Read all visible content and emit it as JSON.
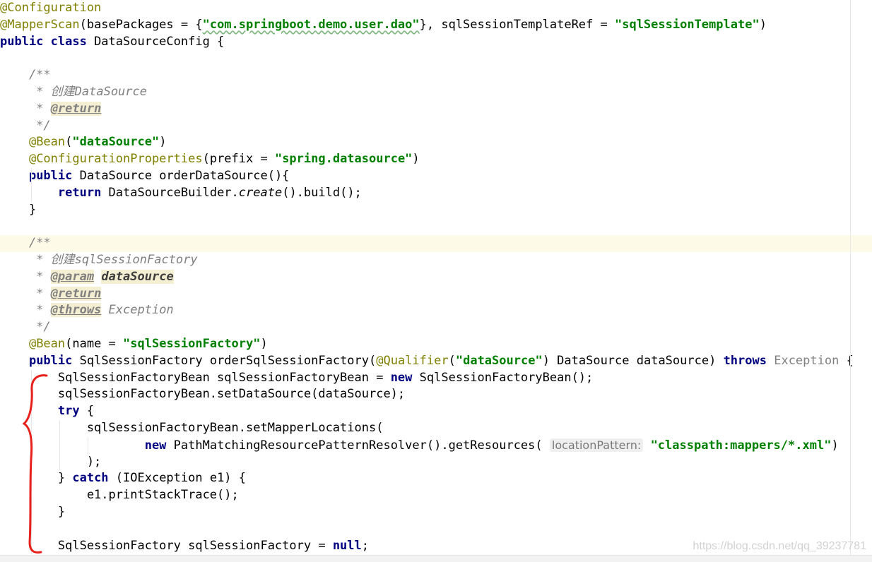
{
  "editor": {
    "lines": [
      [
        {
          "c": "annot",
          "t": "@Configuration"
        }
      ],
      [
        {
          "c": "annot",
          "t": "@MapperScan"
        },
        {
          "c": "",
          "t": "(basePackages = {"
        },
        {
          "c": "str",
          "t": "\"com.springboot.demo.user.dao\"",
          "u": true
        },
        {
          "c": "",
          "t": "}, sqlSessionTemplateRef = "
        },
        {
          "c": "str",
          "t": "\"sqlSessionTemplate\""
        },
        {
          "c": "",
          "t": ")"
        }
      ],
      [
        {
          "c": "kw",
          "t": "public class "
        },
        {
          "c": "",
          "t": "DataSourceConfig {"
        }
      ],
      [],
      [
        {
          "c": "cmt",
          "t": "    /**"
        }
      ],
      [
        {
          "c": "cmt",
          "t": "     * 创建DataSource"
        }
      ],
      [
        {
          "c": "cmt",
          "t": "     * "
        },
        {
          "c": "tag",
          "t": "@return"
        }
      ],
      [
        {
          "c": "cmt",
          "t": "     */"
        }
      ],
      [
        {
          "c": "",
          "t": "    "
        },
        {
          "c": "annot",
          "t": "@Bean"
        },
        {
          "c": "",
          "t": "("
        },
        {
          "c": "str",
          "t": "\"dataSource\""
        },
        {
          "c": "",
          "t": ")"
        }
      ],
      [
        {
          "c": "",
          "t": "    "
        },
        {
          "c": "annot",
          "t": "@ConfigurationProperties"
        },
        {
          "c": "",
          "t": "(prefix = "
        },
        {
          "c": "str",
          "t": "\"spring.datasource\""
        },
        {
          "c": "",
          "t": ")"
        }
      ],
      [
        {
          "c": "",
          "t": "    "
        },
        {
          "c": "kw",
          "t": "public "
        },
        {
          "c": "",
          "t": "DataSource orderDataSource(){"
        }
      ],
      [
        {
          "c": "",
          "t": "        "
        },
        {
          "c": "kw",
          "t": "return "
        },
        {
          "c": "",
          "t": "DataSourceBuilder."
        },
        {
          "c": "ital",
          "t": "create"
        },
        {
          "c": "",
          "t": "().build();"
        }
      ],
      [
        {
          "c": "",
          "t": "    }"
        }
      ],
      [],
      [
        {
          "c": "cmt",
          "t": "    /**"
        }
      ],
      [
        {
          "c": "cmt",
          "t": "     * 创建sqlSessionFactory"
        }
      ],
      [
        {
          "c": "cmt",
          "t": "     * "
        },
        {
          "c": "tag",
          "t": "@param"
        },
        {
          "c": "cmt",
          "t": " "
        },
        {
          "c": "pname",
          "t": "dataSource"
        }
      ],
      [
        {
          "c": "cmt",
          "t": "     * "
        },
        {
          "c": "tag",
          "t": "@return"
        }
      ],
      [
        {
          "c": "cmt",
          "t": "     * "
        },
        {
          "c": "tag",
          "t": "@throws"
        },
        {
          "c": "cmt",
          "t": " Exception"
        }
      ],
      [
        {
          "c": "cmt",
          "t": "     */"
        }
      ],
      [
        {
          "c": "",
          "t": "    "
        },
        {
          "c": "annot",
          "t": "@Bean"
        },
        {
          "c": "",
          "t": "(name = "
        },
        {
          "c": "str",
          "t": "\"sqlSessionFactory\""
        },
        {
          "c": "",
          "t": ")"
        }
      ],
      [
        {
          "c": "",
          "t": "    "
        },
        {
          "c": "kw",
          "t": "public "
        },
        {
          "c": "",
          "t": "SqlSessionFactory orderSqlSessionFactory("
        },
        {
          "c": "annot",
          "t": "@Qualifier"
        },
        {
          "c": "",
          "t": "("
        },
        {
          "c": "str",
          "t": "\"dataSource\""
        },
        {
          "c": "",
          "t": ") DataSource dataSource) "
        },
        {
          "c": "kw",
          "t": "throws "
        },
        {
          "c": "dim",
          "t": "Exception"
        },
        {
          "c": "",
          "t": " {"
        }
      ],
      [
        {
          "c": "",
          "t": "        SqlSessionFactoryBean sqlSessionFactoryBean = "
        },
        {
          "c": "kw",
          "t": "new "
        },
        {
          "c": "",
          "t": "SqlSessionFactoryBean();"
        }
      ],
      [
        {
          "c": "",
          "t": "        sqlSessionFactoryBean.setDataSource(dataSource);"
        }
      ],
      [
        {
          "c": "",
          "t": "        "
        },
        {
          "c": "kw",
          "t": "try "
        },
        {
          "c": "",
          "t": "{"
        }
      ],
      [
        {
          "c": "",
          "t": "            sqlSessionFactoryBean.setMapperLocations("
        }
      ],
      [
        {
          "c": "",
          "t": "                    "
        },
        {
          "c": "kw",
          "t": "new "
        },
        {
          "c": "",
          "t": "PathMatchingResourcePatternResolver().getResources( "
        },
        {
          "c": "hint",
          "t": "locationPattern:"
        },
        {
          "c": "",
          "t": " "
        },
        {
          "c": "str",
          "t": "\"classpath:mappers/*.xml\""
        },
        {
          "c": "",
          "t": ")"
        }
      ],
      [
        {
          "c": "",
          "t": "            );"
        }
      ],
      [
        {
          "c": "",
          "t": "        } "
        },
        {
          "c": "kw",
          "t": "catch "
        },
        {
          "c": "",
          "t": "(IOException e1) {"
        }
      ],
      [
        {
          "c": "",
          "t": "            e1.printStackTrace();"
        }
      ],
      [
        {
          "c": "",
          "t": "        }"
        }
      ],
      [],
      [
        {
          "c": "",
          "t": "        SqlSessionFactory sqlSessionFactory = "
        },
        {
          "c": "kw",
          "t": "null"
        },
        {
          "c": "",
          "t": ";"
        }
      ]
    ],
    "highlighted_line": 14
  },
  "watermark": "https://blog.csdn.net/qq_39237781",
  "colors": {
    "annotation": "#808000",
    "keyword": "#000080",
    "string": "#008000",
    "comment": "#808080",
    "current_line": "#fdfbe8",
    "red_marker": "#e8201c"
  }
}
